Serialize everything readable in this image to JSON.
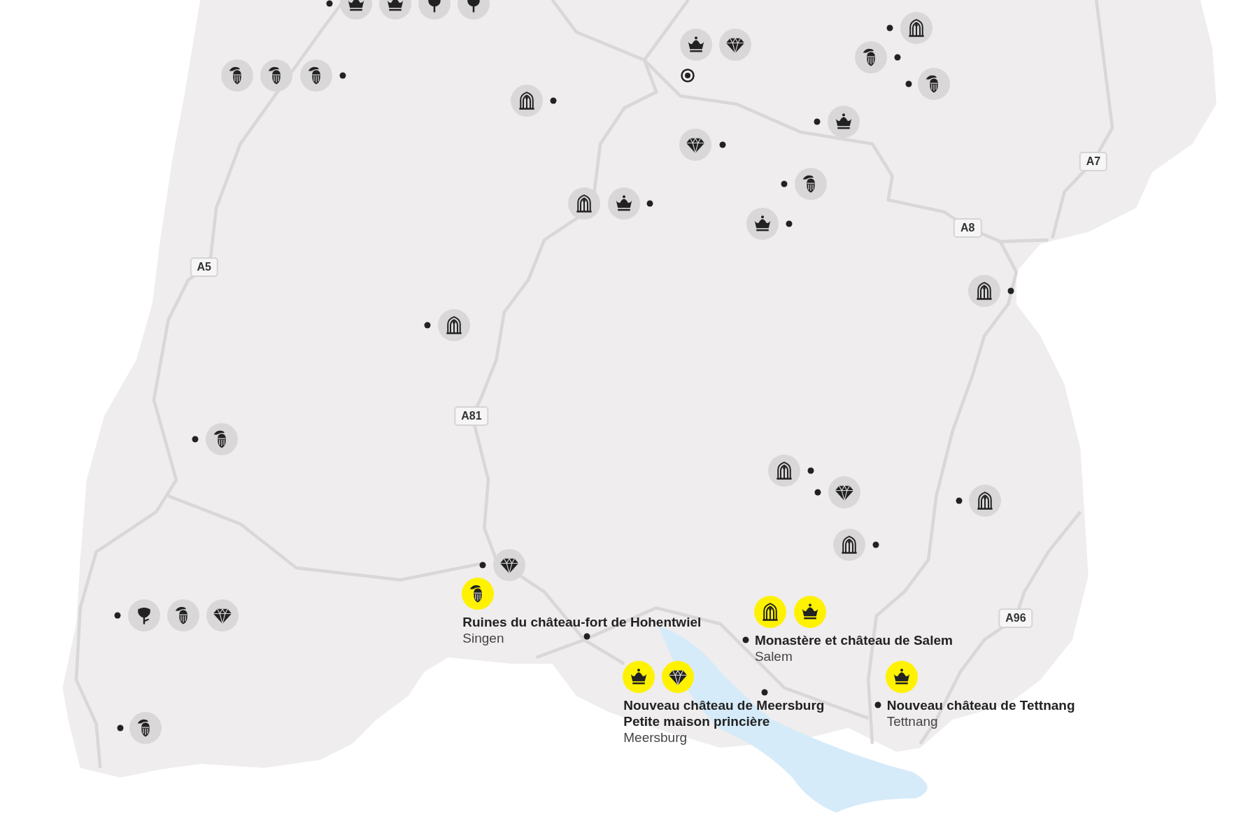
{
  "map": {
    "roads": [
      {
        "label": "A7"
      },
      {
        "label": "A8"
      },
      {
        "label": "A5"
      },
      {
        "label": "A81"
      },
      {
        "label": "A96"
      }
    ],
    "sites": [
      {
        "icons": [
          {
            "kind": "crown"
          },
          {
            "kind": "crown"
          },
          {
            "kind": "tree"
          },
          {
            "kind": "tree"
          }
        ],
        "highlighted": false
      },
      {
        "icons": [
          {
            "kind": "helmet"
          },
          {
            "kind": "helmet"
          },
          {
            "kind": "helmet"
          }
        ],
        "highlighted": false
      },
      {
        "icons": [
          {
            "kind": "church"
          }
        ],
        "highlighted": false
      },
      {
        "icons": [
          {
            "kind": "crown"
          },
          {
            "kind": "diamond"
          }
        ],
        "highlighted": false
      },
      {
        "icons": [
          {
            "kind": "church"
          }
        ],
        "highlighted": false
      },
      {
        "icons": [
          {
            "kind": "helmet"
          }
        ],
        "highlighted": false
      },
      {
        "icons": [
          {
            "kind": "helmet"
          }
        ],
        "highlighted": false
      },
      {
        "icons": [
          {
            "kind": "crown"
          }
        ],
        "highlighted": false
      },
      {
        "icons": [
          {
            "kind": "diamond"
          }
        ],
        "highlighted": false
      },
      {
        "icons": [
          {
            "kind": "helmet"
          }
        ],
        "highlighted": false
      },
      {
        "icons": [
          {
            "kind": "church"
          },
          {
            "kind": "crown"
          }
        ],
        "highlighted": false
      },
      {
        "icons": [
          {
            "kind": "crown"
          }
        ],
        "highlighted": false
      },
      {
        "icons": [
          {
            "kind": "church"
          }
        ],
        "highlighted": false
      },
      {
        "icons": [
          {
            "kind": "church"
          }
        ],
        "highlighted": false
      },
      {
        "icons": [
          {
            "kind": "helmet"
          }
        ],
        "highlighted": false
      },
      {
        "icons": [
          {
            "kind": "church"
          }
        ],
        "highlighted": false
      },
      {
        "icons": [
          {
            "kind": "diamond"
          }
        ],
        "highlighted": false
      },
      {
        "icons": [
          {
            "kind": "church"
          }
        ],
        "highlighted": false
      },
      {
        "icons": [
          {
            "kind": "church"
          }
        ],
        "highlighted": false
      },
      {
        "icons": [
          {
            "kind": "diamond"
          }
        ],
        "highlighted": false
      },
      {
        "icons": [
          {
            "kind": "rose"
          },
          {
            "kind": "helmet"
          },
          {
            "kind": "diamond"
          }
        ],
        "highlighted": false
      },
      {
        "icons": [
          {
            "kind": "helmet"
          }
        ],
        "highlighted": false
      },
      {
        "icons": [
          {
            "kind": "helmet"
          }
        ],
        "highlighted": true,
        "names": [
          "Ruines du château-fort de Hohentwiel"
        ],
        "town": "Singen"
      },
      {
        "icons": [
          {
            "kind": "church"
          },
          {
            "kind": "crown"
          }
        ],
        "highlighted": true,
        "names": [
          "Monastère et château de Salem"
        ],
        "town": "Salem"
      },
      {
        "icons": [
          {
            "kind": "crown"
          },
          {
            "kind": "diamond"
          }
        ],
        "highlighted": true,
        "names": [
          "Nouveau château de Meersburg",
          "Petite maison princière"
        ],
        "town": "Meersburg"
      },
      {
        "icons": [
          {
            "kind": "crown"
          }
        ],
        "highlighted": true,
        "names": [
          "Nouveau château de Tettnang"
        ],
        "town": "Tettnang"
      }
    ]
  }
}
